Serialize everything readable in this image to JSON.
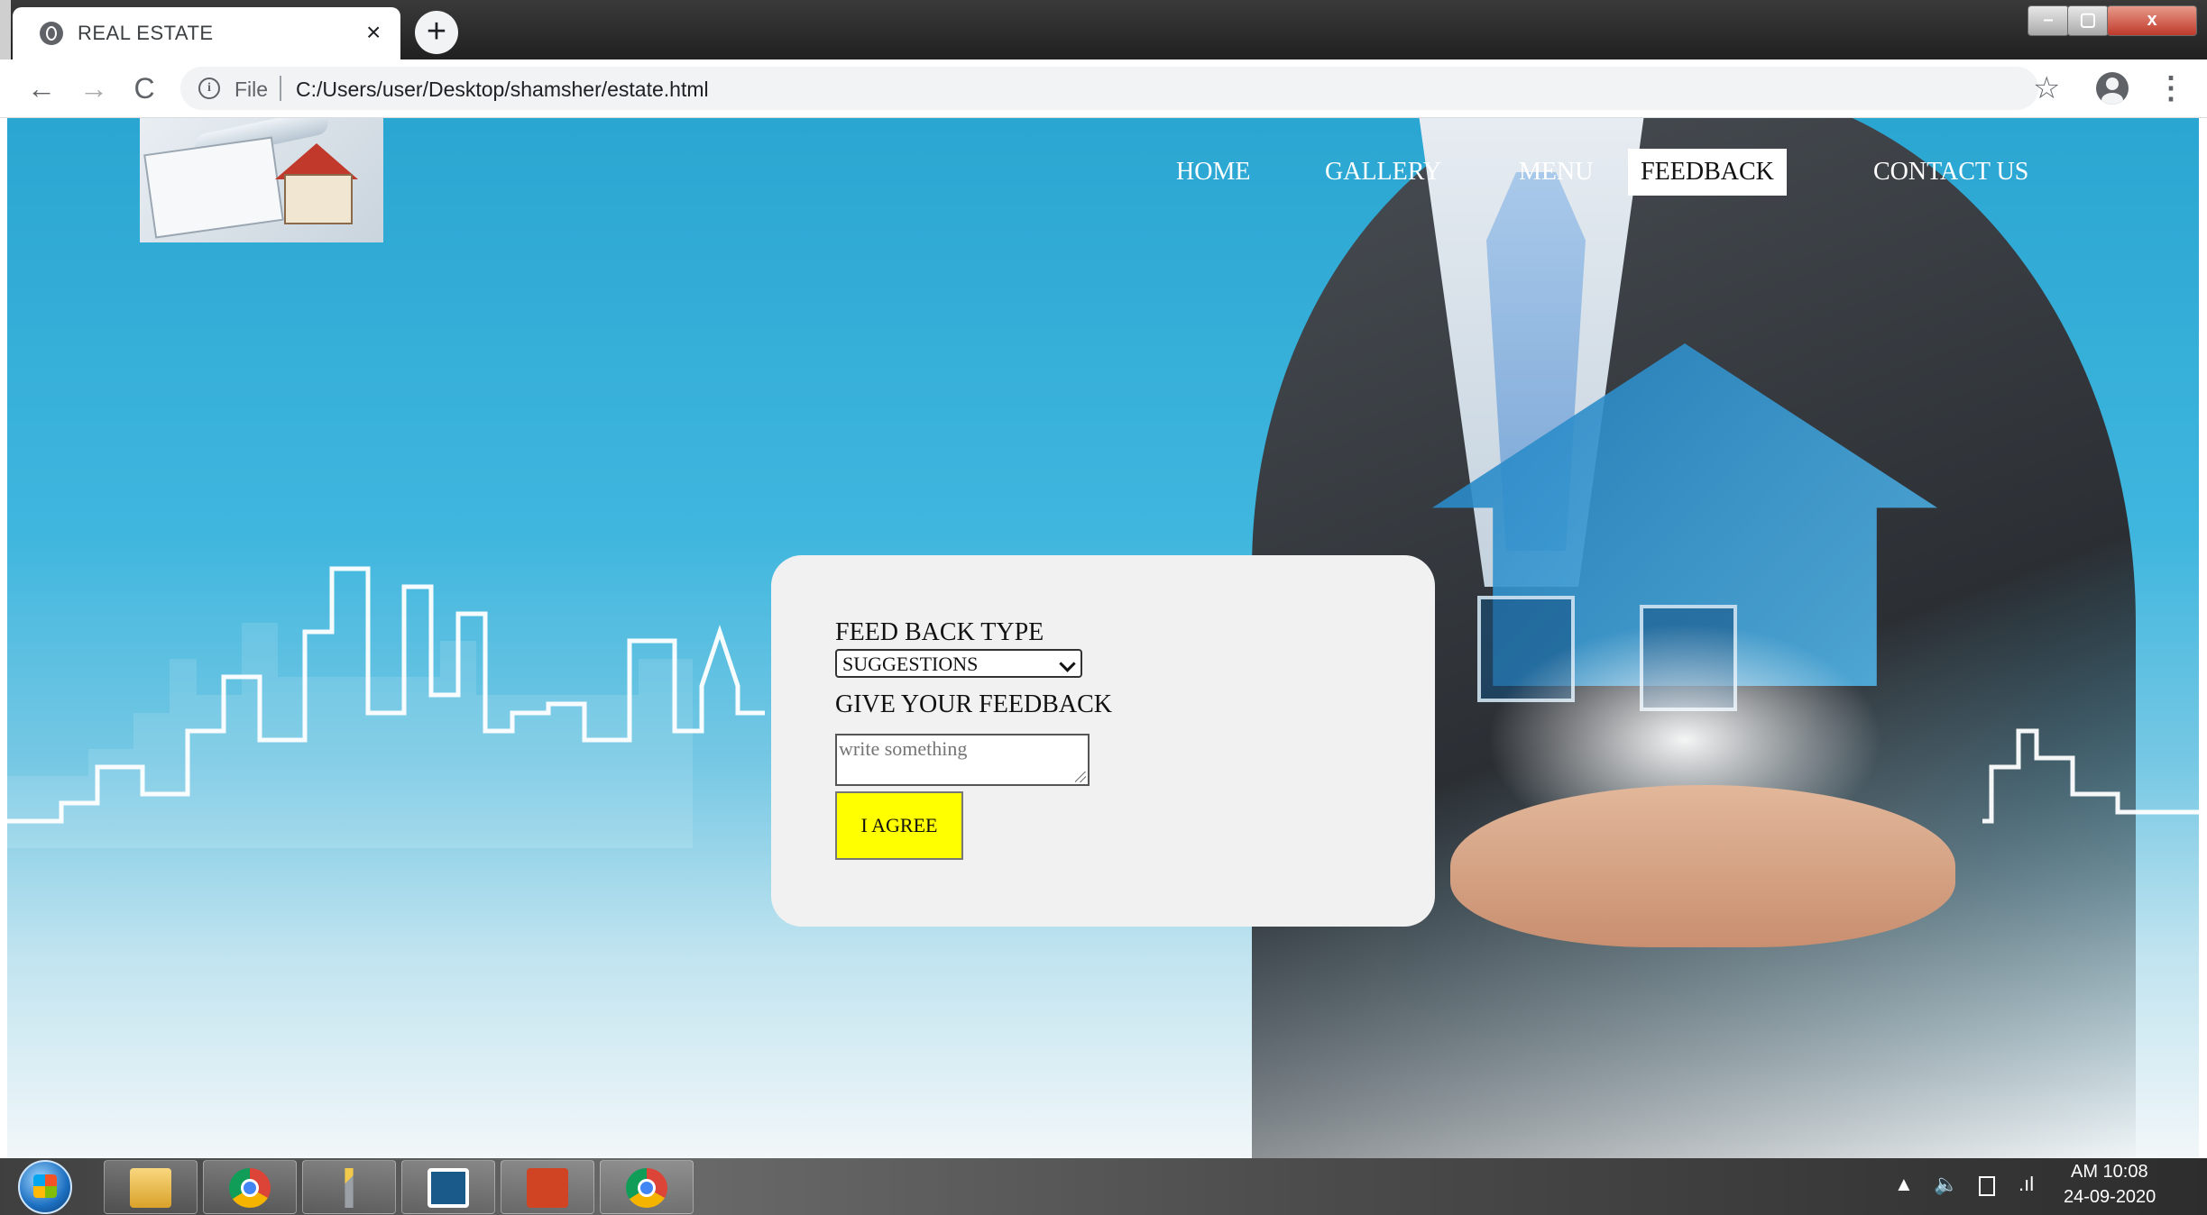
{
  "browser": {
    "tab_title": "REAL ESTATE",
    "tab_close": "×",
    "new_tab": "+",
    "scheme_label": "File",
    "url": "C:/Users/user/Desktop/shamsher/estate.html",
    "back": "←",
    "forward": "→",
    "reload": "C",
    "star": "☆",
    "kebab": "⋮",
    "win_min": "–",
    "win_max": "▢",
    "win_close": "x"
  },
  "site": {
    "nav": {
      "home": "HOME",
      "gallery": "GALLERY",
      "menu": "MENU",
      "feedback": "FEEDBACK",
      "contact": "CONTACT US"
    },
    "feedback_form": {
      "type_label": "FEED BACK TYPE",
      "type_selected": "SUGGESTIONS",
      "give_label": "GIVE YOUR FEEDBACK",
      "textarea_placeholder": "write something",
      "agree_button": "I AGREE"
    }
  },
  "taskbar": {
    "clock_time": "AM 10:08",
    "clock_date": "24-09-2020",
    "tray_arrow": "▲",
    "tray_volume": "🔈",
    "tray_signal": ".ıl"
  },
  "colors": {
    "agree_button": "#ffff00",
    "card_background": "#f1f1f1",
    "sky_accent": "#2aa6d2"
  }
}
